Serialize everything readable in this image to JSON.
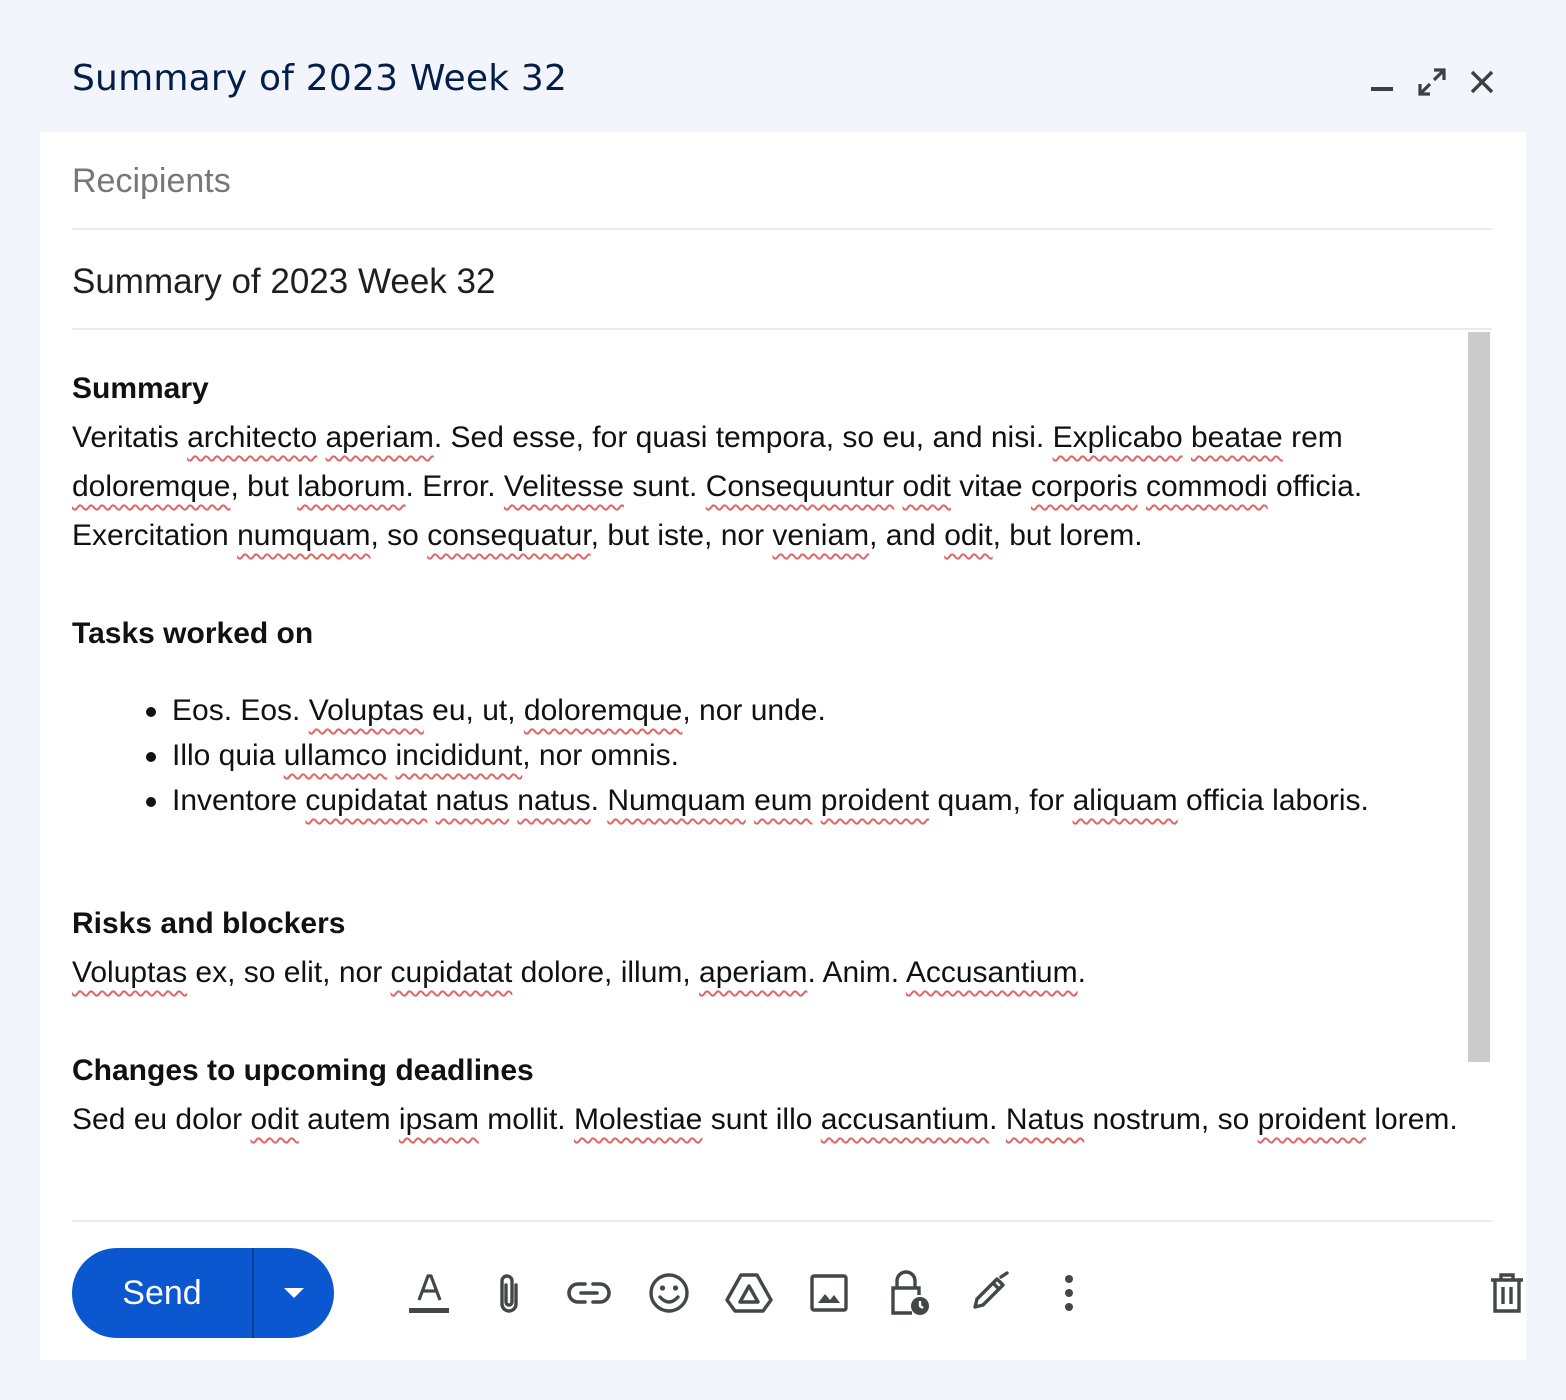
{
  "window": {
    "title": "Summary of 2023 Week 32",
    "controls": [
      "minimize-icon",
      "expand-icon",
      "close-icon"
    ]
  },
  "compose": {
    "recipients_placeholder": "Recipients",
    "subject": "Summary of 2023 Week 32"
  },
  "body": {
    "summary_heading": "Summary",
    "summary_text": [
      {
        "t": "Veritatis "
      },
      {
        "t": "architecto",
        "s": true
      },
      {
        "t": " "
      },
      {
        "t": "aperiam",
        "s": true
      },
      {
        "t": ". Sed esse, for quasi tempora, so eu, and nisi. "
      },
      {
        "t": "Explicabo",
        "s": true
      },
      {
        "t": " "
      },
      {
        "t": "beatae",
        "s": true
      },
      {
        "t": " rem "
      },
      {
        "t": "doloremque",
        "s": true
      },
      {
        "t": ", but "
      },
      {
        "t": "laborum",
        "s": true
      },
      {
        "t": ". Error. "
      },
      {
        "t": "Velitesse",
        "s": true
      },
      {
        "t": " sunt. "
      },
      {
        "t": "Consequuntur",
        "s": true
      },
      {
        "t": " "
      },
      {
        "t": "odit",
        "s": true
      },
      {
        "t": " vitae "
      },
      {
        "t": "corporis",
        "s": true
      },
      {
        "t": " "
      },
      {
        "t": "commodi",
        "s": true
      },
      {
        "t": " officia. Exercitation "
      },
      {
        "t": "numquam",
        "s": true
      },
      {
        "t": ", so "
      },
      {
        "t": "consequatur",
        "s": true
      },
      {
        "t": ", but iste, nor "
      },
      {
        "t": "veniam",
        "s": true
      },
      {
        "t": ", and "
      },
      {
        "t": "odit",
        "s": true
      },
      {
        "t": ", but lorem."
      }
    ],
    "tasks_heading": "Tasks worked on",
    "tasks": [
      [
        {
          "t": "Eos. Eos. "
        },
        {
          "t": "Voluptas",
          "s": true
        },
        {
          "t": " eu, ut, "
        },
        {
          "t": "doloremque",
          "s": true
        },
        {
          "t": ", nor unde."
        }
      ],
      [
        {
          "t": "Illo quia "
        },
        {
          "t": "ullamco",
          "s": true
        },
        {
          "t": " "
        },
        {
          "t": "incididunt",
          "s": true
        },
        {
          "t": ", nor omnis."
        }
      ],
      [
        {
          "t": "Inventore "
        },
        {
          "t": "cupidatat",
          "s": true
        },
        {
          "t": " "
        },
        {
          "t": "natus",
          "s": true
        },
        {
          "t": " "
        },
        {
          "t": "natus",
          "s": true
        },
        {
          "t": ". "
        },
        {
          "t": "Numquam",
          "s": true
        },
        {
          "t": " "
        },
        {
          "t": "eum",
          "s": true
        },
        {
          "t": " "
        },
        {
          "t": "proident",
          "s": true
        },
        {
          "t": " quam, for "
        },
        {
          "t": "aliquam",
          "s": true
        },
        {
          "t": " officia laboris."
        }
      ]
    ],
    "risks_heading": "Risks and blockers",
    "risks_text": [
      {
        "t": "Voluptas",
        "s": true
      },
      {
        "t": " ex, so elit, nor "
      },
      {
        "t": "cupidatat",
        "s": true
      },
      {
        "t": " dolore, illum, "
      },
      {
        "t": "aperiam",
        "s": true
      },
      {
        "t": ". Anim. "
      },
      {
        "t": "Accusantium",
        "s": true
      },
      {
        "t": "."
      }
    ],
    "deadlines_heading": "Changes to upcoming deadlines",
    "deadlines_text": [
      {
        "t": "Sed eu dolor "
      },
      {
        "t": "odit",
        "s": true
      },
      {
        "t": " autem "
      },
      {
        "t": "ipsam",
        "s": true
      },
      {
        "t": " mollit. "
      },
      {
        "t": "Molestiae",
        "s": true
      },
      {
        "t": " sunt illo "
      },
      {
        "t": "accusantium",
        "s": true
      },
      {
        "t": ". "
      },
      {
        "t": "Natus",
        "s": true
      },
      {
        "t": " nostrum, so "
      },
      {
        "t": "proident",
        "s": true
      },
      {
        "t": " lorem."
      }
    ]
  },
  "toolbar": {
    "send_label": "Send",
    "tools": [
      "formatting-icon",
      "attach-icon",
      "link-icon",
      "emoji-icon",
      "drive-icon",
      "photo-icon",
      "confidential-mode-icon",
      "signature-icon",
      "more-options-icon"
    ],
    "delete": "trash-icon"
  },
  "colors": {
    "accent": "#0b57d0",
    "title": "#041e49",
    "background": "#f2f6fc",
    "spellcheck": "#e06666"
  }
}
